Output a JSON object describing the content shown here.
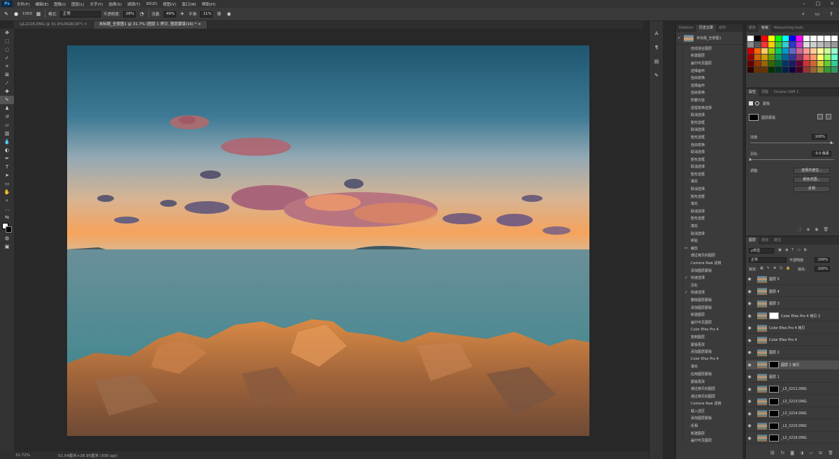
{
  "menubar": {
    "logo": "Ps",
    "items": [
      "文件(F)",
      "编辑(E)",
      "图像(I)",
      "图层(L)",
      "文字(Y)",
      "选择(S)",
      "滤镜(T)",
      "3D(D)",
      "视图(V)",
      "窗口(W)",
      "帮助(H)"
    ],
    "minimize": "–",
    "maximize": "□",
    "close": "×"
  },
  "options": {
    "brush_size": "1000",
    "mode_label": "模式:",
    "mode_value": "正常",
    "opacity_label": "不透明度:",
    "opacity_value": "28%",
    "flow_label": "流量:",
    "flow_value": "49%",
    "smooth_label": "平滑:",
    "smooth_value": "11%"
  },
  "tabs": [
    {
      "label": "LJL2218.DNG @ 31.9%(RGB/16*)"
    },
    {
      "label": "未标题_全景图1 @ 31.7% (图层 1 拷贝, 图层蒙版/16) *"
    }
  ],
  "status": {
    "zoom": "31.72%",
    "size": "51.54厘米×28.95厘米 (300 ppi)"
  },
  "history_panel": {
    "tabs": [
      "Deletion",
      "历史记录",
      "动作"
    ],
    "snapshot": "未标题_全景图1",
    "items": [
      {
        "icon": "",
        "label": "自动混合图层"
      },
      {
        "icon": "",
        "label": "新建图层"
      },
      {
        "icon": "",
        "label": "盖印可见图层"
      },
      {
        "icon": "",
        "label": "选择画布"
      },
      {
        "icon": "",
        "label": "自由变换"
      },
      {
        "icon": "",
        "label": "选择画布"
      },
      {
        "icon": "",
        "label": "自由变换"
      },
      {
        "icon": "",
        "label": "附着内容"
      },
      {
        "icon": "",
        "label": "透视变换选择"
      },
      {
        "icon": "",
        "label": "取消选择"
      },
      {
        "icon": "",
        "label": "矩形选框"
      },
      {
        "icon": "",
        "label": "取消选择"
      },
      {
        "icon": "",
        "label": "矩形选框"
      },
      {
        "icon": "",
        "label": "自由变换"
      },
      {
        "icon": "",
        "label": "取消选择"
      },
      {
        "icon": "",
        "label": "矩形选框"
      },
      {
        "icon": "",
        "label": "取消选择"
      },
      {
        "icon": "",
        "label": "矩形选框"
      },
      {
        "icon": "",
        "label": "填充"
      },
      {
        "icon": "",
        "label": "取消选择"
      },
      {
        "icon": "",
        "label": "矩形选框"
      },
      {
        "icon": "",
        "label": "填充"
      },
      {
        "icon": "",
        "label": "取消选择"
      },
      {
        "icon": "",
        "label": "矩形选框"
      },
      {
        "icon": "",
        "label": "填充"
      },
      {
        "icon": "",
        "label": "取消选择"
      },
      {
        "icon": "",
        "label": "拼贴"
      },
      {
        "icon": "✂",
        "label": "裁剪"
      },
      {
        "icon": "",
        "label": "通过拷贝的图层"
      },
      {
        "icon": "",
        "label": "Camera Raw 滤镜"
      },
      {
        "icon": "",
        "label": "添加图层蒙版"
      },
      {
        "icon": "✓",
        "label": "快速选择"
      },
      {
        "icon": "",
        "label": "羽化"
      },
      {
        "icon": "✓",
        "label": "快速选择"
      },
      {
        "icon": "",
        "label": "删除图层蒙版"
      },
      {
        "icon": "",
        "label": "添加图层蒙版"
      },
      {
        "icon": "",
        "label": "新建图层"
      },
      {
        "icon": "",
        "label": "盖印可见图层"
      },
      {
        "icon": "",
        "label": "Color Efex Pro 4"
      },
      {
        "icon": "",
        "label": "复制图层"
      },
      {
        "icon": "",
        "label": "蒙版更改"
      },
      {
        "icon": "",
        "label": "添加图层蒙版"
      },
      {
        "icon": "",
        "label": "Color Efex Pro 4"
      },
      {
        "icon": "",
        "label": "填充"
      },
      {
        "icon": "",
        "label": "应用图层蒙版"
      },
      {
        "icon": "",
        "label": "蒙版更改"
      },
      {
        "icon": "",
        "label": "通过拷贝的图层"
      },
      {
        "icon": "",
        "label": "通过拷贝的图层"
      },
      {
        "icon": "",
        "label": "Camera Raw 滤镜"
      },
      {
        "icon": "",
        "label": "载入选区"
      },
      {
        "icon": "",
        "label": "添加图层蒙版"
      },
      {
        "icon": "",
        "label": "反相"
      },
      {
        "icon": "",
        "label": "新建图层"
      },
      {
        "icon": "",
        "label": "盖印可见图层"
      }
    ]
  },
  "swatches_panel": {
    "tabs": [
      "颜色",
      "色板",
      "Retouching tools"
    ],
    "colors": [
      "#ffffff",
      "#000000",
      "#ff0000",
      "#ffff00",
      "#00ff00",
      "#00ffff",
      "#0000ff",
      "#ff00ff",
      "#ffffff",
      "#ffffff",
      "#ffffff",
      "#ffffff",
      "#ffffff",
      "#8c8c8c",
      "#595959",
      "#ff3333",
      "#ffcc00",
      "#33cc33",
      "#33cccc",
      "#3333cc",
      "#cc33cc",
      "#dddddd",
      "#cccccc",
      "#bbbbbb",
      "#aaaaaa",
      "#999999",
      "#cc0000",
      "#ff6600",
      "#ffcc66",
      "#99cc00",
      "#00cc66",
      "#0099cc",
      "#6666cc",
      "#cc6699",
      "#ff9999",
      "#ffcc99",
      "#ffff99",
      "#ccff99",
      "#99ffcc",
      "#990000",
      "#cc6600",
      "#cc9900",
      "#669900",
      "#009966",
      "#006699",
      "#333399",
      "#993366",
      "#ff6666",
      "#ff9966",
      "#ffff66",
      "#99ff66",
      "#66ffcc",
      "#660000",
      "#993300",
      "#996600",
      "#336600",
      "#006633",
      "#003366",
      "#1a1a66",
      "#660033",
      "#cc3333",
      "#cc6633",
      "#cccc33",
      "#66cc33",
      "#33cc99",
      "#330000",
      "#663300",
      "#663300",
      "#003300",
      "#003322",
      "#002244",
      "#110044",
      "#440022",
      "#993333",
      "#996633",
      "#999933",
      "#339933",
      "#339966"
    ]
  },
  "properties_panel": {
    "tabs": [
      "属性",
      "调整",
      "Double USM 2"
    ],
    "mask_label": "蒙版",
    "layer_mask_label": "图层蒙版",
    "density_label": "浓度:",
    "density_value": "100%",
    "feather_label": "羽化:",
    "feather_value": "0.0 像素",
    "adjust_label": "调整:",
    "btn_select_mask": "选择并遮住...",
    "btn_color_range": "颜色范围...",
    "btn_invert": "反相"
  },
  "layers_panel": {
    "tabs": [
      "图层",
      "通道",
      "路径"
    ],
    "filter_label": "ρ类型",
    "blend_mode": "正常",
    "opacity_label": "不透明度:",
    "opacity_value": "100%",
    "lock_label": "锁定:",
    "fill_label": "填充:",
    "fill_value": "100%",
    "layers": [
      {
        "name": "图层 5",
        "mask": false,
        "mask_color": "",
        "selected": false
      },
      {
        "name": "图层 4",
        "mask": false,
        "mask_color": "",
        "selected": false
      },
      {
        "name": "图层 3",
        "mask": false,
        "mask_color": "",
        "selected": false
      },
      {
        "name": "Color Efex Pro 4 拷贝 2",
        "mask": true,
        "mask_color": "#ffffff",
        "selected": false
      },
      {
        "name": "Color Efex Pro 4 拷贝",
        "mask": false,
        "mask_color": "",
        "selected": false
      },
      {
        "name": "Color Efex Pro 4",
        "mask": false,
        "mask_color": "",
        "selected": false
      },
      {
        "name": "图层 2",
        "mask": false,
        "mask_color": "",
        "selected": false
      },
      {
        "name": "图层 1 拷贝",
        "mask": true,
        "mask_color": "#000000",
        "selected": true
      },
      {
        "name": "图层 1",
        "mask": false,
        "mask_color": "",
        "selected": false
      },
      {
        "name": "_L3_2211.DNG",
        "mask": true,
        "mask_color": "#000000",
        "selected": false
      },
      {
        "name": "_L3_2213.DNG",
        "mask": true,
        "mask_color": "#000000",
        "selected": false
      },
      {
        "name": "_L3_2214.DNG",
        "mask": true,
        "mask_color": "#000000",
        "selected": false
      },
      {
        "name": "_L3_2215.DNG",
        "mask": true,
        "mask_color": "#000000",
        "selected": false
      },
      {
        "name": "_L3_2216.DNG",
        "mask": true,
        "mask_color": "#000000",
        "selected": false
      }
    ]
  }
}
